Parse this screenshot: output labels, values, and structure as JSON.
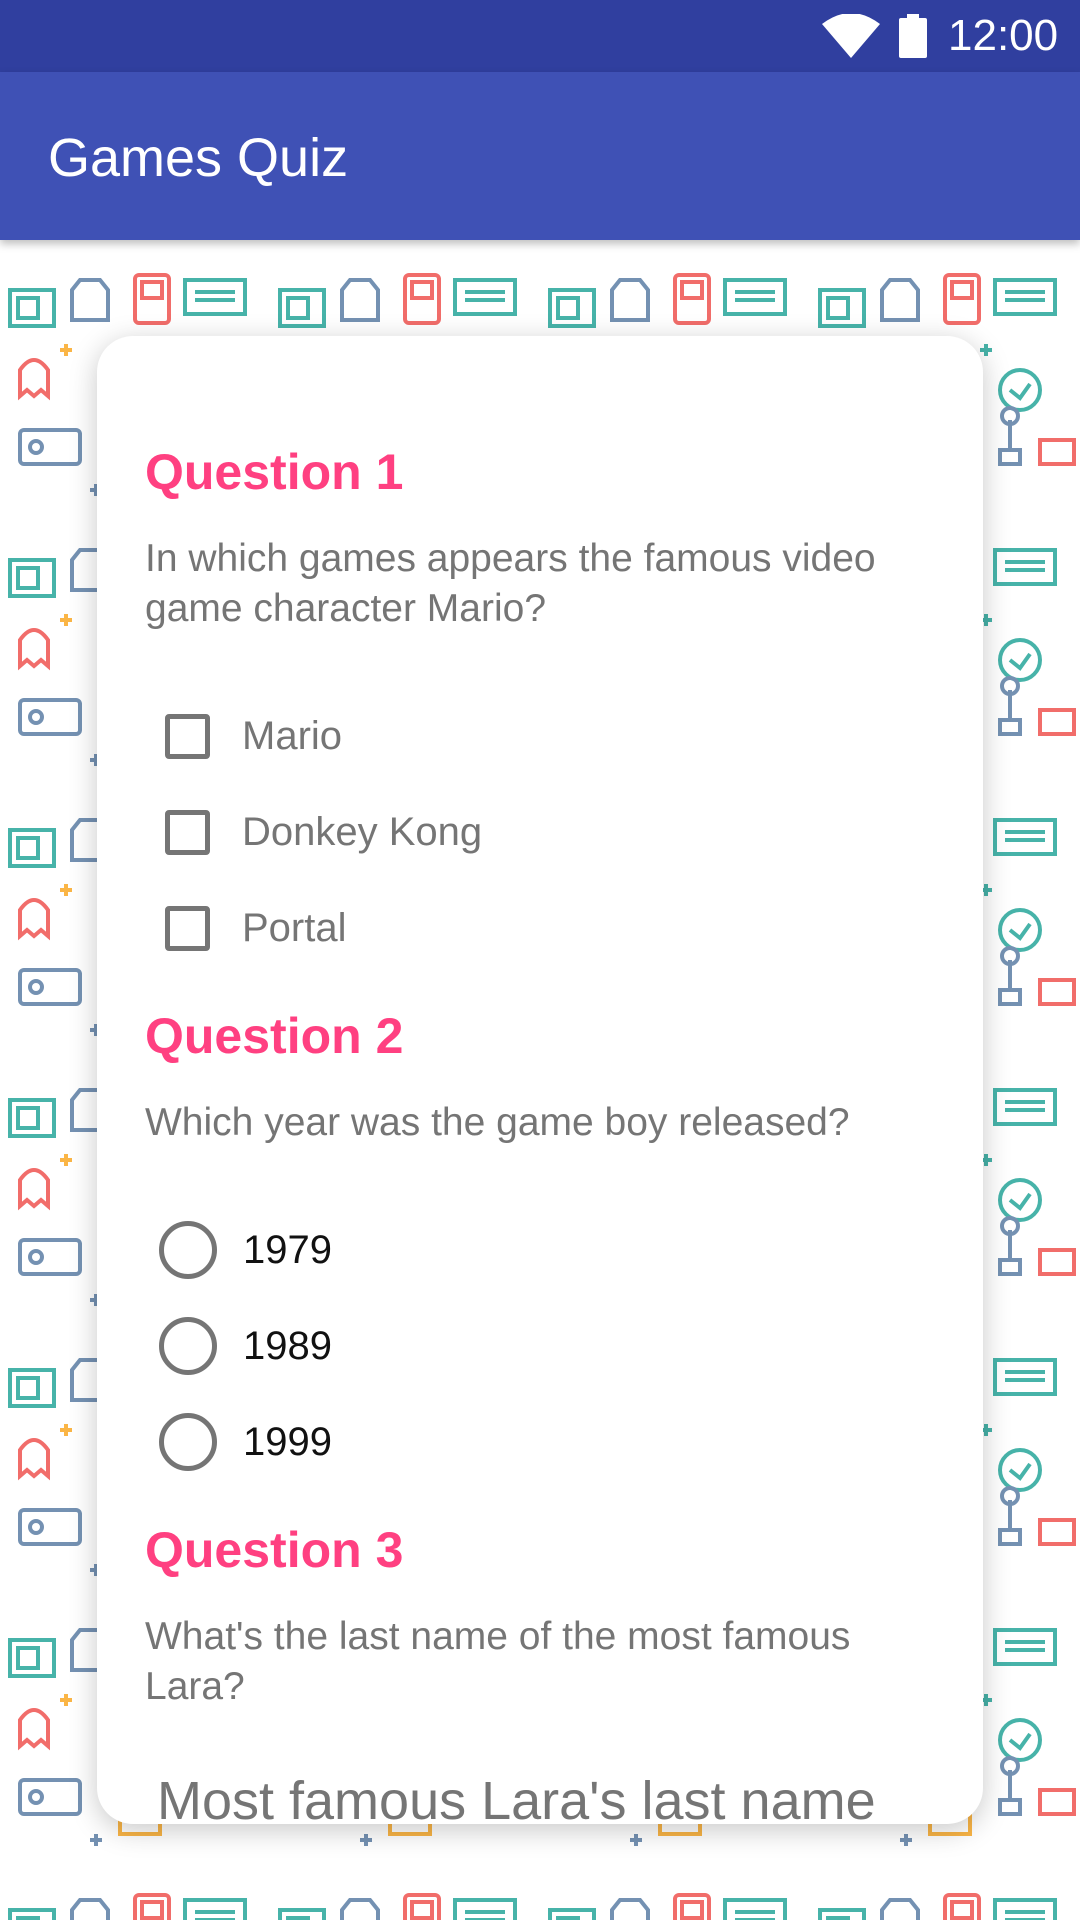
{
  "status_bar": {
    "time": "12:00",
    "icons": [
      "wifi-icon",
      "battery-icon"
    ]
  },
  "app_bar": {
    "title": "Games Quiz"
  },
  "colors": {
    "primary": "#3f51b5",
    "primary_dark": "#303f9f",
    "accent": "#ff4081"
  },
  "questions": [
    {
      "title": "Question 1",
      "text": "In which games appears the famous video game character Mario?",
      "type": "checkbox",
      "options": [
        "Mario",
        "Donkey Kong",
        "Portal"
      ]
    },
    {
      "title": "Question 2",
      "text": "Which year was the game boy released?",
      "type": "radio",
      "options": [
        "1979",
        "1989",
        "1999"
      ]
    },
    {
      "title": "Question 3",
      "text": "What's the last name of the most famous Lara?",
      "type": "text",
      "placeholder": "Most famous Lara's last name"
    }
  ]
}
